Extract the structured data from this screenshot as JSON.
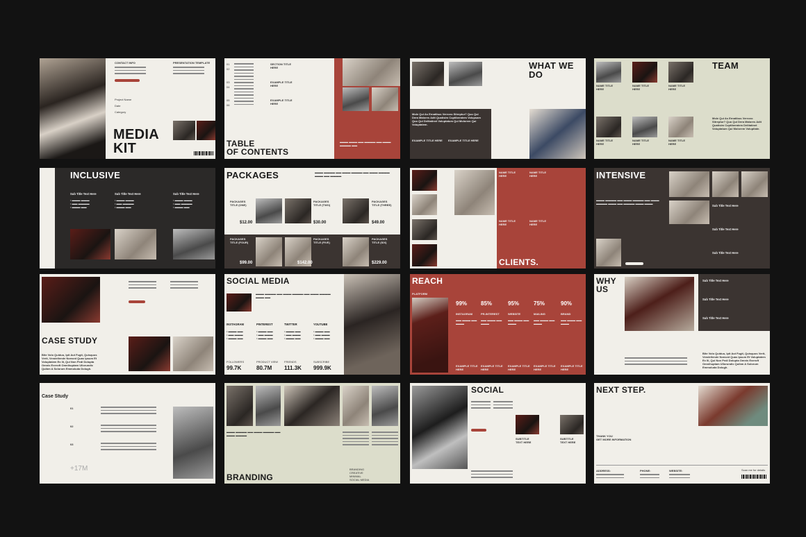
{
  "colors": {
    "background": "#121212",
    "paper": "#f1efe9",
    "rust": "#a8443a",
    "dark": "#3b3431",
    "sage": "#dcddcb"
  },
  "media_kit": {
    "title_line1": "MEDIA",
    "title_line2": "KIT",
    "contact_label": "CONTACT INFO",
    "template_label": "PRESENTATION TEMPLATE",
    "rows": [
      "Project Name",
      "Date",
      "Category"
    ]
  },
  "toc": {
    "title_line1": "TABLE",
    "title_line2": "OF CONTENTS",
    "items": [
      "SECTION TITLE HERE",
      "EXAMPLE TITLE HERE",
      "EXAMPLE TITLE HERE"
    ],
    "numbers": [
      "01",
      "02",
      "03",
      "04",
      "05",
      "06"
    ]
  },
  "what_we_do": {
    "title_line1": "WHAT WE",
    "title_line2": "DO",
    "quote": "Mole Qui As Ernatibus Verrovo Sitreptur? Quo Qui Dera Malores Adit Quatisim Cuptiberatem Volupsam Quo Qui Delitatinet Voluptatum Qui Molorem Qui Voluptatem.",
    "ex1": "EXAMPLE TITLE HERE",
    "ex2": "EXAMPLE TITLE HERE"
  },
  "team": {
    "title": "TEAM",
    "name": "NAME TITLE HERE",
    "quote": "Mole Qui As Ernatibus Verrovo Sitreptur? Quo Qui Dera Malores Adit Quatisim Cuptiberatem Delitatinet Voluptatum Qui Molorem Volupitate."
  },
  "inclusive": {
    "title": "INCLUSIVE",
    "sub": "Sub Title Text Here"
  },
  "packages": {
    "title": "PACKAGES",
    "items": [
      {
        "name": "PACKAGES TITLE (ONE)",
        "price": "$12.00"
      },
      {
        "name": "PACKAGES TITLE (TWO)",
        "price": "$30.00"
      },
      {
        "name": "PACKAGES TITLE (THREE)",
        "price": "$49.00"
      },
      {
        "name": "PACKAGES TITLE (FOUR)",
        "price": "$99.00"
      },
      {
        "name": "PACKAGES TITLE (FIVE)",
        "price": "$142.00"
      },
      {
        "name": "PACKAGES TITLE (SIX)",
        "price": "$229.00"
      }
    ]
  },
  "clients": {
    "title": "CLIENTS.",
    "name": "NAME TITLE HERE"
  },
  "intensive": {
    "title": "INTENSIVE",
    "sub": "Sub Title Text Here"
  },
  "case_study": {
    "title": "CASE STUDY",
    "quote": "Bite Volo Quiduo, Ipit Aut Fugit, Quisquos Verit, Vendellende Nonsed Quas Ipsum Et Voluptatem Ex Ili, Qui Non Pedi Dolupta Omnis Exeroft Omnihuptam Ullorundic Quibm A Solorum Emmoluda Dolugh."
  },
  "social_media": {
    "title": "SOCIAL MEDIA",
    "platforms": [
      {
        "name": "INSTAGRAM",
        "label": "FOLLOWERS",
        "value": "99.7K"
      },
      {
        "name": "PINTEREST",
        "label": "PRODUCT VIEW",
        "value": "80.7M"
      },
      {
        "name": "TWITTER",
        "label": "FRIENDS",
        "value": "111.3K"
      },
      {
        "name": "YOUTUBE",
        "label": "SUBSCRIBE",
        "value": "999.9K"
      }
    ]
  },
  "reach": {
    "title": "REACH",
    "platform": "PLATFORM",
    "stats": [
      {
        "pct": "99%",
        "name": "INSTAGRAM"
      },
      {
        "pct": "85%",
        "name": "PR-INTEREST"
      },
      {
        "pct": "95%",
        "name": "WEBSITE"
      },
      {
        "pct": "75%",
        "name": "MAILING"
      },
      {
        "pct": "90%",
        "name": "BRAND"
      }
    ],
    "ex": "EXAMPLE TITLE HERE"
  },
  "why_us": {
    "title_line1": "WHY",
    "title_line2": "US",
    "sub": "Sub Title Text Here",
    "quote": "Bite Volo Quiduo, Ipit Aut Fugit, Quisquos Verit, Vendellende Nonsed Quas Ipsum Et Voluptatem Ex Ili, Qui Non Pedi Dolupta Omnis Exeroft Omnihuptam Ullorundic Quibm A Solorum Emmoluda Dolugh."
  },
  "case_study2": {
    "title": "Case Study",
    "stat": "+17M",
    "rows": [
      "01",
      "02",
      "03"
    ]
  },
  "branding": {
    "title": "BRANDING",
    "list": [
      "BRANDING",
      "CREATIVE",
      "MINIMAL",
      "SOCIAL MEDIA"
    ]
  },
  "social": {
    "title": "SOCIAL",
    "sub": "SUBTITLE TEXT HERE"
  },
  "next_step": {
    "title": "NEXT STEP.",
    "thank": "THANK YOU",
    "more": "GET MORE INFORMATION",
    "address": "ADDRESS:",
    "phone": "PHONE:",
    "website": "WEBSITE:",
    "scan": "Scan me for details"
  }
}
